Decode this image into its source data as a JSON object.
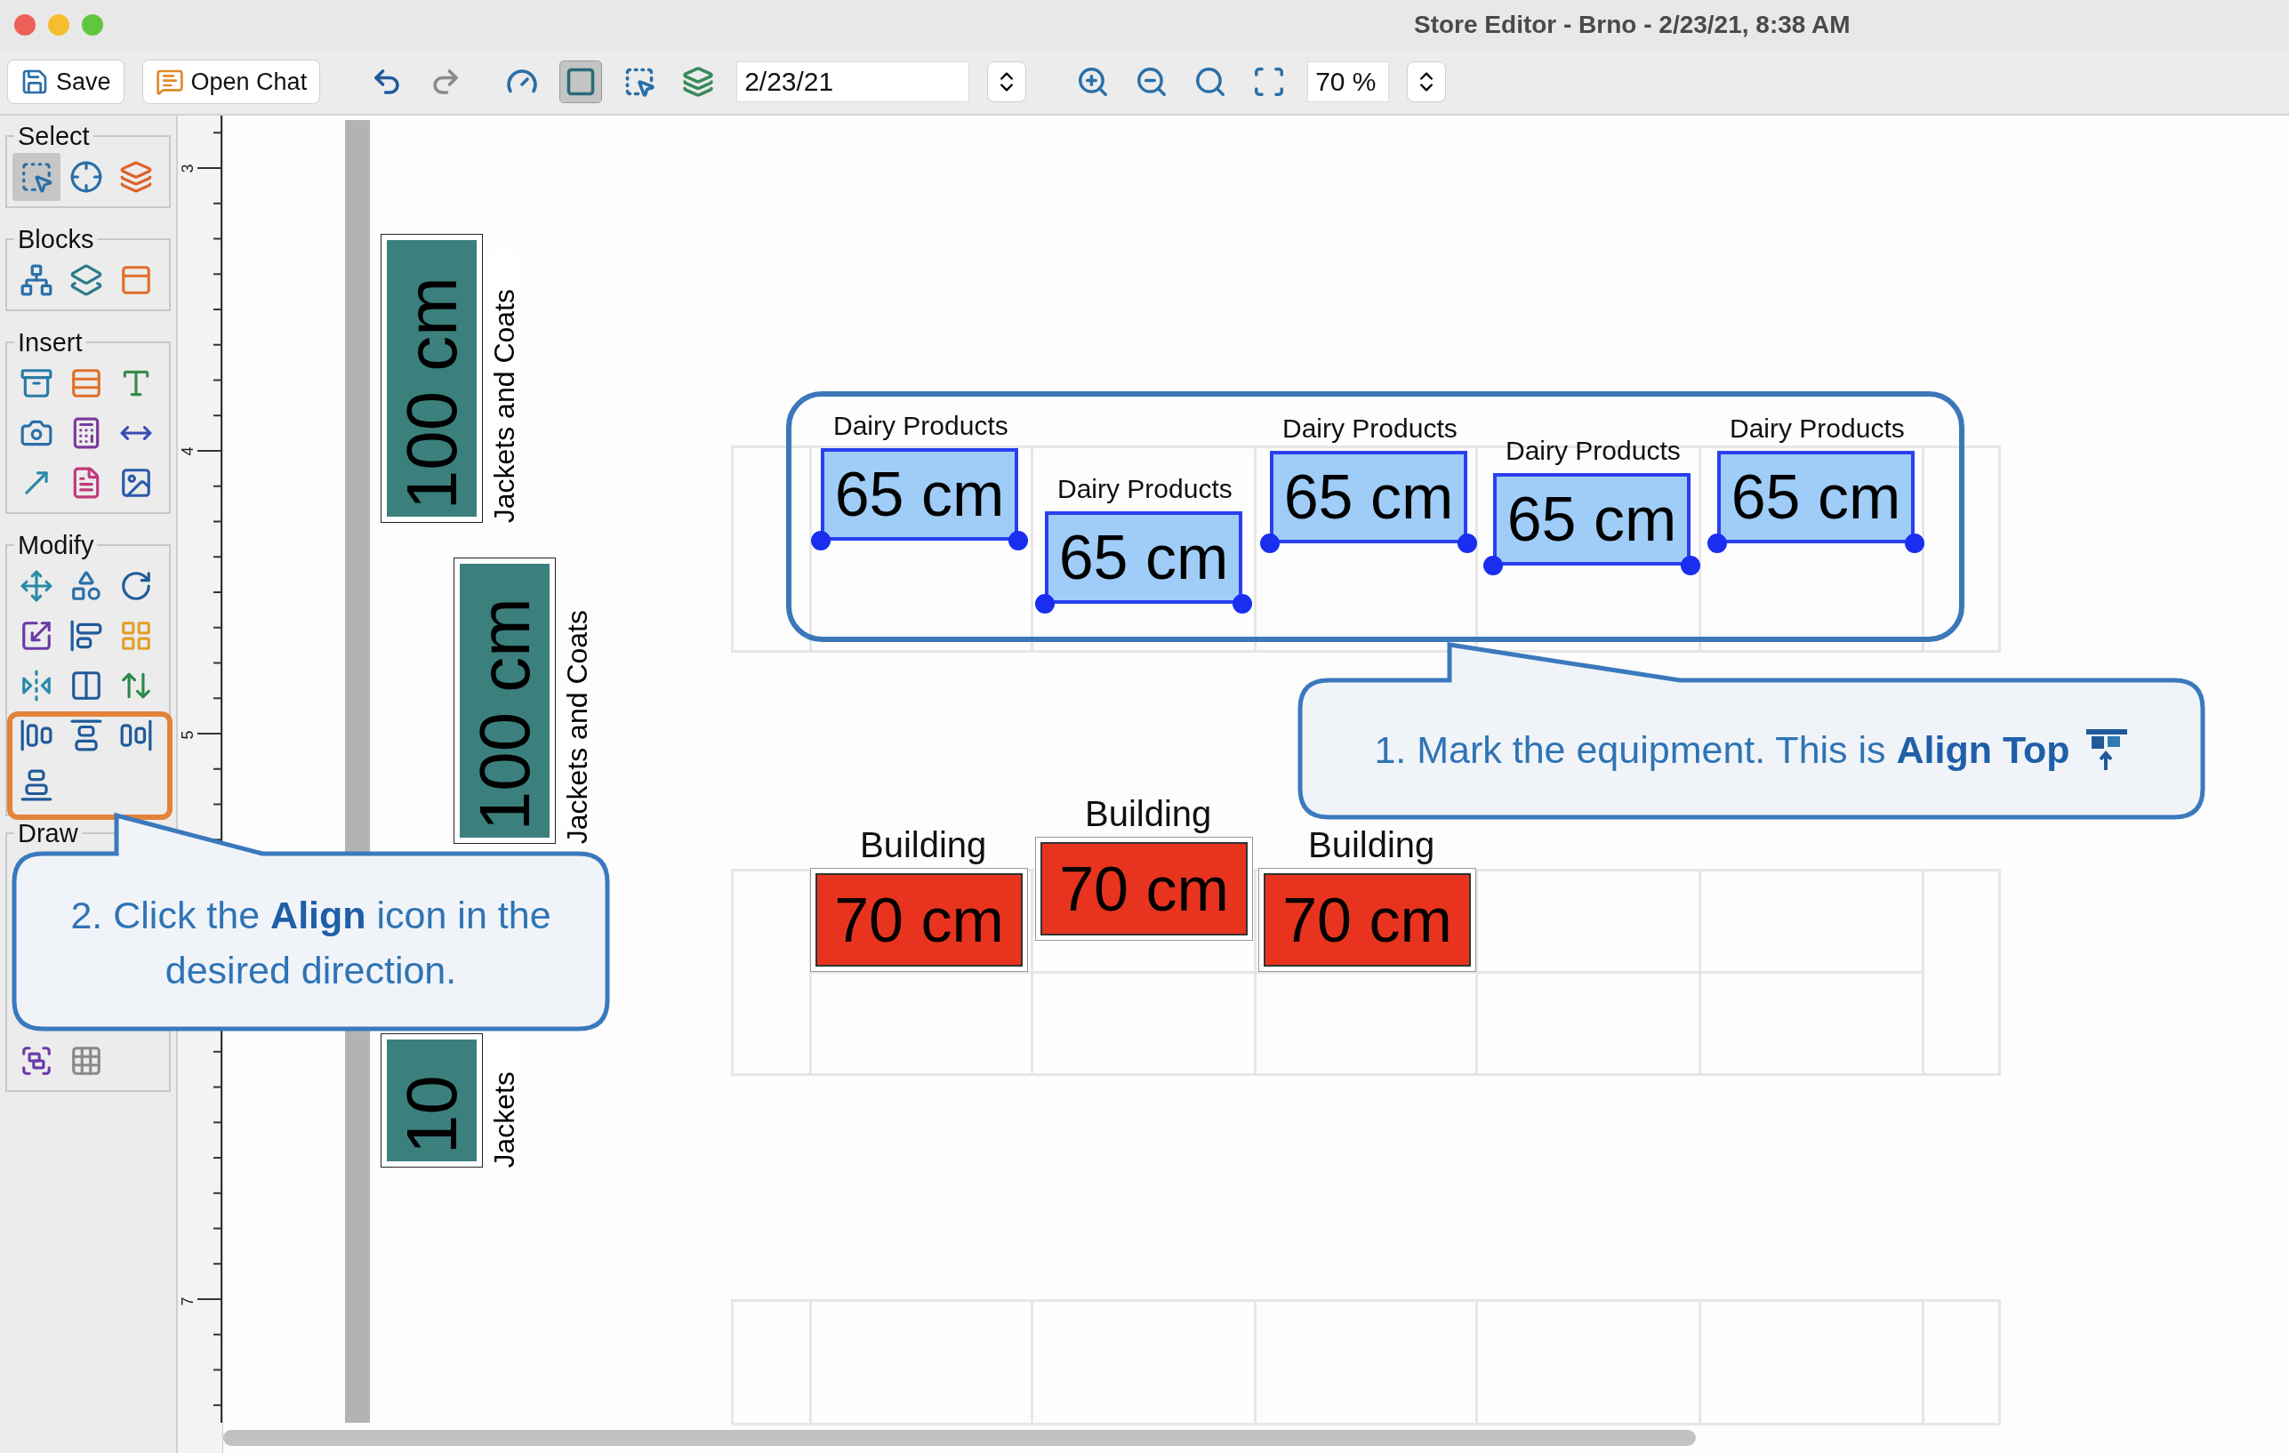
{
  "window": {
    "title": "Store Editor - Brno - 2/23/21, 8:38 AM"
  },
  "toolbar": {
    "buttons": [
      {
        "label": "Save"
      },
      {
        "label": "Open Chat"
      }
    ],
    "tools": [
      {
        "selected": false
      },
      {
        "selected": false
      },
      {
        "selected": false
      },
      {
        "selected": true
      },
      {
        "selected": false
      },
      {
        "selected": false
      }
    ],
    "date_field": {
      "value": "2/23/21"
    },
    "zoom_tools": [
      {
        "selected": false
      },
      {
        "selected": false
      },
      {
        "selected": false
      },
      {
        "selected": false
      }
    ],
    "zoom_field": {
      "value": "70 %"
    }
  },
  "palette": {
    "groups": [
      {
        "title": "Select",
        "tools": [
          {
            "selected": true
          },
          {
            "selected": false
          },
          {
            "selected": false
          }
        ]
      },
      {
        "title": "Blocks",
        "tools": [
          {
            "selected": false
          },
          {
            "selected": false
          },
          {
            "selected": false
          }
        ]
      },
      {
        "title": "Insert",
        "tools": [
          {
            "selected": false
          },
          {
            "selected": false
          },
          {
            "selected": false
          },
          {
            "selected": false
          },
          {
            "selected": false
          },
          {
            "selected": false
          },
          {
            "selected": false
          },
          {
            "selected": false
          },
          {
            "selected": false
          }
        ]
      },
      {
        "title": "Modify",
        "tools": [
          {
            "selected": false
          },
          {
            "selected": false
          },
          {
            "selected": false
          },
          {
            "selected": false
          },
          {
            "selected": false
          },
          {
            "selected": false
          },
          {
            "selected": false
          },
          {
            "selected": false
          },
          {
            "selected": false
          },
          {
            "selected": false
          },
          {
            "selected": false
          },
          {
            "selected": false
          },
          {
            "selected": false
          }
        ]
      },
      {
        "title": "Draw",
        "tools": [
          {
            "selected": false
          },
          {
            "selected": false
          }
        ]
      }
    ]
  },
  "ruler": {
    "labels": [
      "3",
      "4",
      "5",
      "7"
    ]
  },
  "canvas": {
    "jacket_shelves": [
      {
        "size": "100 cm",
        "label": "Jackets and Coats",
        "color": "#3b807d"
      },
      {
        "size": "100 cm",
        "label": "Jackets and Coats",
        "color": "#3b807d"
      },
      {
        "size": "10",
        "label": "Jackets",
        "color": "#3b807d"
      }
    ],
    "dairy_items": [
      {
        "label": "Dairy Products",
        "size": "65 cm",
        "color": "#9fcdf8",
        "selected": true
      },
      {
        "label": "Dairy Products",
        "size": "65 cm",
        "color": "#9fcdf8",
        "selected": true
      },
      {
        "label": "Dairy Products",
        "size": "65 cm",
        "color": "#9fcdf8",
        "selected": true
      },
      {
        "label": "Dairy Products",
        "size": "65 cm",
        "color": "#9fcdf8",
        "selected": true
      },
      {
        "label": "Dairy Products",
        "size": "65 cm",
        "color": "#9fcdf8",
        "selected": true
      }
    ],
    "building_items": [
      {
        "label": "Building",
        "size": "70 cm",
        "color": "#e8341f",
        "selected": false
      },
      {
        "label": "Building",
        "size": "70 cm",
        "color": "#e8341f",
        "selected": false
      },
      {
        "label": "Building",
        "size": "70 cm",
        "color": "#e8341f",
        "selected": false
      }
    ]
  },
  "callouts": [
    {
      "text": "1. Mark the equipment. This is **Align Top**"
    },
    {
      "text": "2. Click the **Align** icon in the desired direction."
    }
  ]
}
